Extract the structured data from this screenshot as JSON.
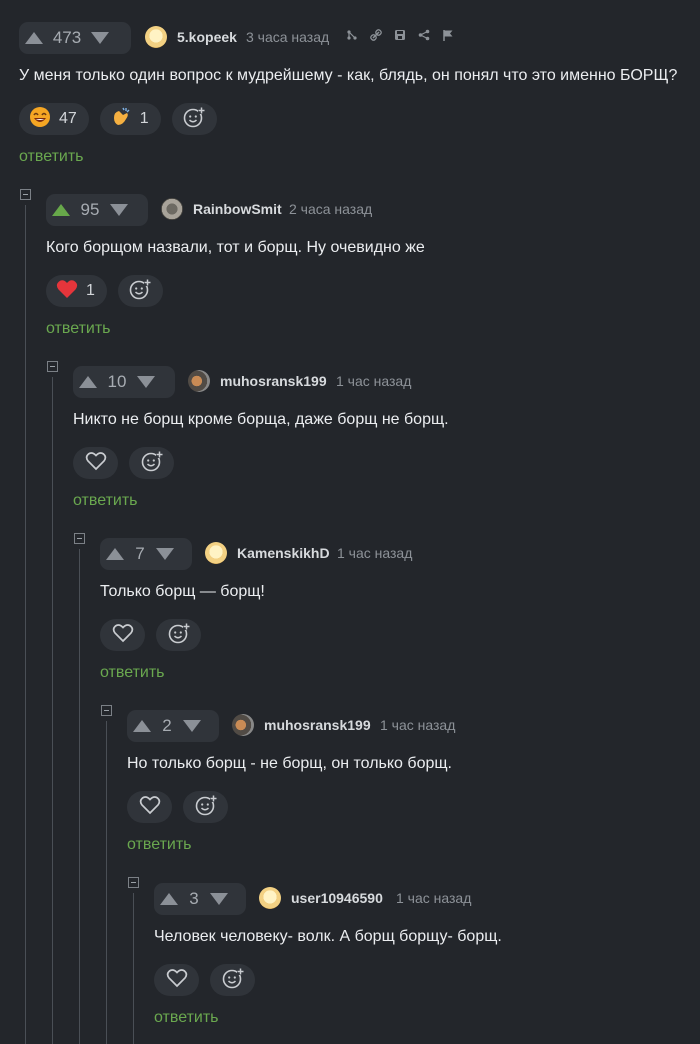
{
  "comments": [
    {
      "votes": "473",
      "author": "5.kopeek",
      "time": "3 часа назад",
      "text": "У меня только один вопрос к мудрейшему - как, блядь, он понял что это именно БОРЩ?",
      "reactions": [
        {
          "icon": "laughing-face-icon",
          "count": "47"
        },
        {
          "icon": "clapping-hands-icon",
          "count": "1"
        }
      ],
      "reply_label": "ответить",
      "avatar": "cookie-avatar"
    },
    {
      "votes": "95",
      "author": "RainbowSmit",
      "time": "2 часа назад",
      "text": "Кого борщом назвали, тот и борщ. Ну очевидно же",
      "reactions": [
        {
          "icon": "red-heart-icon",
          "count": "1"
        }
      ],
      "reply_label": "ответить",
      "avatar": "sloth-avatar",
      "upvoted": true
    },
    {
      "votes": "10",
      "author": "muhosransk199",
      "time": "1 час назад",
      "text": "Никто не борщ кроме борща, даже борщ не борщ.",
      "reply_label": "ответить",
      "avatar": "dog-avatar"
    },
    {
      "votes": "7",
      "author": "KamenskikhD",
      "time": "1 час назад",
      "text": "Только борщ — борщ!",
      "reply_label": "ответить",
      "avatar": "cookie-avatar"
    },
    {
      "votes": "2",
      "author": "muhosransk199",
      "time": "1 час назад",
      "text": "Но только борщ - не борщ, он только борщ.",
      "reply_label": "ответить",
      "avatar": "dog-avatar"
    },
    {
      "votes": "3",
      "author": "user10946590",
      "time": "1 час назад",
      "text": "Человек человеку- волк. А борщ борщу- борщ.",
      "reply_label": "ответить",
      "avatar": "cookie-avatar"
    }
  ],
  "colors": {
    "background": "#23262b",
    "pill": "#30343a",
    "reply": "#6aa84f",
    "upvote_active": "#67a84a",
    "heart": "#e5353b"
  }
}
